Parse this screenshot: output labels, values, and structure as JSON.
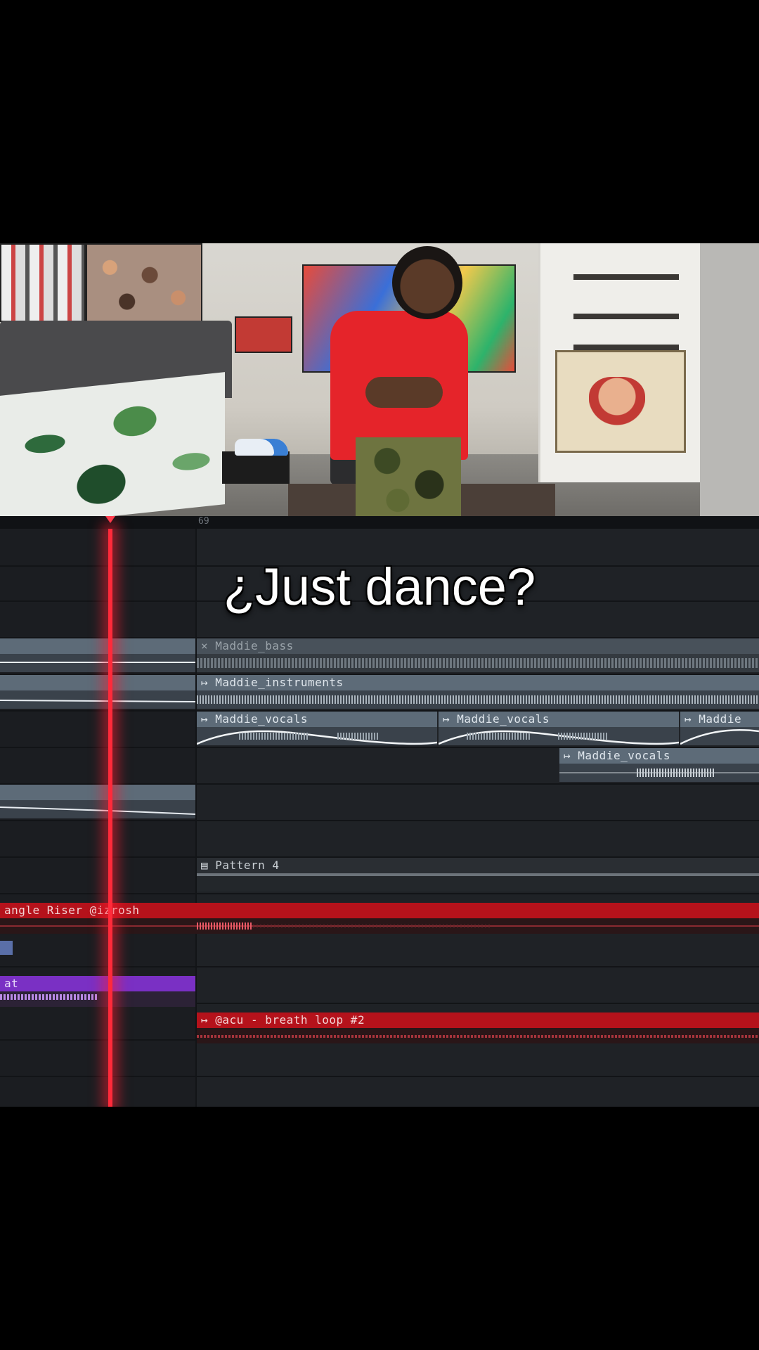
{
  "caption": "¿Just dance?",
  "ruler": {
    "bar_number": "69"
  },
  "clips": {
    "bass": "Maddie_bass",
    "instruments": "Maddie_instruments",
    "vocals_1": "Maddie_vocals",
    "vocals_2": "Maddie_vocals",
    "vocals_3": "Maddie",
    "vocals_4": "Maddie_vocals",
    "pattern": "Pattern 4",
    "riser": "angle Riser @izrosh",
    "purple": "at",
    "breath": "@acu - breath loop #2"
  },
  "icons": {
    "muted": "×",
    "audio_clip": "↦",
    "pattern_clip": "▤"
  },
  "colors": {
    "playhead": "#ff2a3a",
    "audio_clip_header": "#5d6b78",
    "red_clip": "#b5121b",
    "purple_clip": "#7a30c4",
    "background": "#1f2226"
  }
}
